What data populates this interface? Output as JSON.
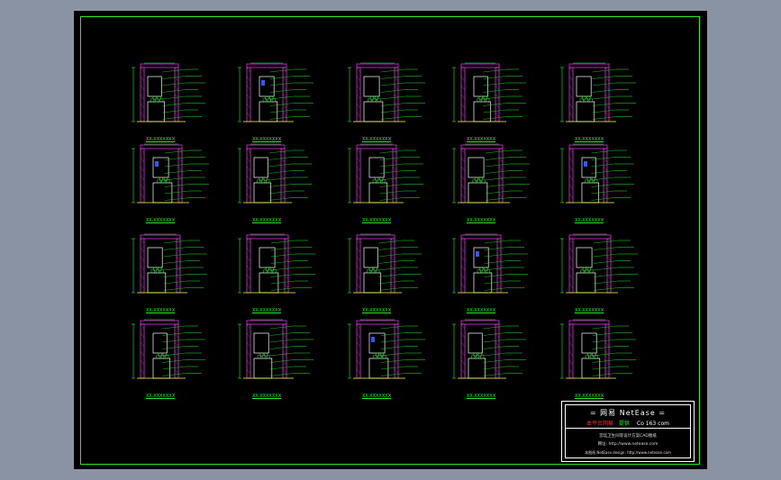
{
  "sheet": {
    "colors": {
      "background": "#8a93a3",
      "paper": "#000000",
      "frame": "#22ee22",
      "wall_hatch": "#dd33dd",
      "fixture": "#ffffff",
      "leader": "#22ee22",
      "floor": "#ffff44",
      "accent_blue": "#3355ff",
      "accent_red": "#ff3030"
    }
  },
  "drawings": [
    {
      "caption": "XX-XXXXXXX"
    },
    {
      "caption": "XX-XXXXXXX"
    },
    {
      "caption": "XX-XXXXXXX"
    },
    {
      "caption": "XX-XXXXXXX"
    },
    {
      "caption": "XX-XXXXXXX"
    },
    {
      "caption": "XX-XXXXXXX"
    },
    {
      "caption": "XX-XXXXXXX"
    },
    {
      "caption": "XX-XXXXXXX"
    },
    {
      "caption": "XX-XXXXXXX"
    },
    {
      "caption": "XX-XXXXXXX"
    },
    {
      "caption": "XX-XXXXXXX"
    },
    {
      "caption": "XX-XXXXXXX"
    },
    {
      "caption": "XX-XXXXXXX"
    },
    {
      "caption": "XX-XXXXXXX"
    },
    {
      "caption": "XX-XXXXXXX"
    },
    {
      "caption": "XX-XXXXXXX"
    },
    {
      "caption": "XX-XXXXXXX"
    },
    {
      "caption": "XX-XXXXXXX"
    },
    {
      "caption": "XX-XXXXXXX"
    },
    {
      "caption": "XX-XXXXXXX"
    }
  ],
  "title_block": {
    "brand": "= 网易 NetEase =",
    "sub_red": "本平台网易",
    "sub_green": "提供",
    "sub_white": "Co 163 com",
    "line1": "宫廷卫生间等设计方案CAD图纸",
    "line2": "网址: http://www.netease.com",
    "line3": "本图纸 NetEase.design: http://www.netease.com"
  }
}
